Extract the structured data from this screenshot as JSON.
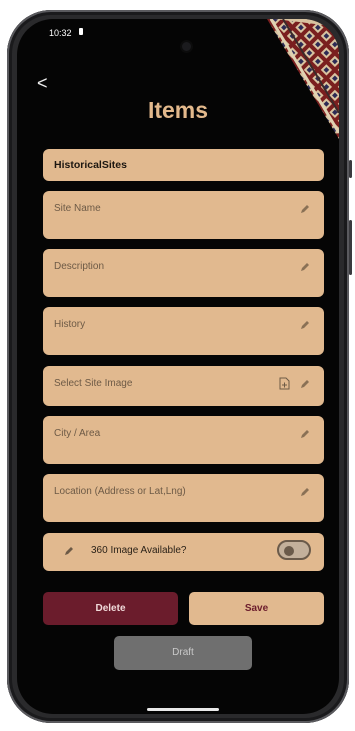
{
  "status_bar": {
    "time": "10:32"
  },
  "nav": {
    "back_glyph": "<"
  },
  "page": {
    "title": "Items"
  },
  "form": {
    "category": "HistoricalSites",
    "fields": [
      {
        "label": "Site Name"
      },
      {
        "label": "Description"
      },
      {
        "label": "History"
      },
      {
        "label": "Select Site Image"
      },
      {
        "label": "City / Area"
      },
      {
        "label": "Location (Address or Lat,Lng)"
      }
    ],
    "toggle": {
      "label": "360 Image Available?",
      "on": false
    }
  },
  "actions": {
    "delete": "Delete",
    "save": "Save",
    "draft": "Draft"
  },
  "colors": {
    "accent": "#e3b98c",
    "field_bg": "#e1b98f",
    "delete_bg": "#6b1c2c",
    "draft_bg": "#6f6f6f",
    "background": "#050505"
  }
}
